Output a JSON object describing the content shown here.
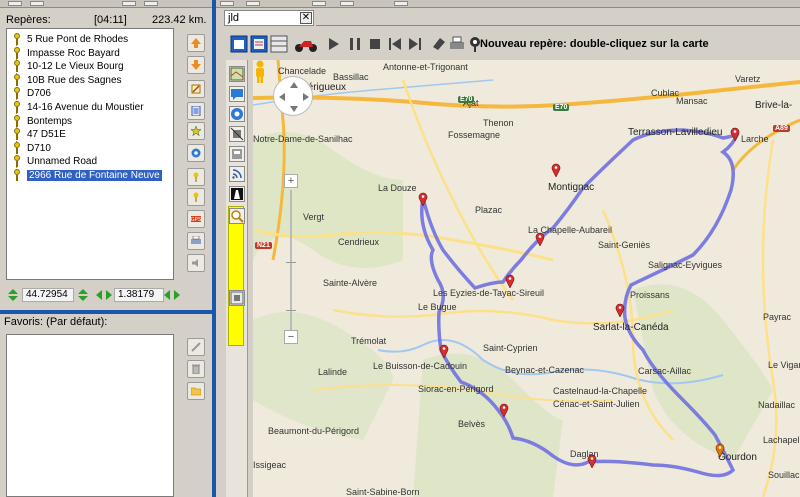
{
  "left_panel": {
    "waypoints_title": "Repères:",
    "duration": "[04:11]",
    "distance": "223.42 km.",
    "waypoints": [
      {
        "label": "5 Rue Pont de Rhodes",
        "selected": false
      },
      {
        "label": "Impasse Roc Bayard",
        "selected": false
      },
      {
        "label": "10-12 Le Vieux Bourg",
        "selected": false
      },
      {
        "label": "10B Rue des Sagnes",
        "selected": false
      },
      {
        "label": "D706",
        "selected": false
      },
      {
        "label": "14-16 Avenue du Moustier",
        "selected": false
      },
      {
        "label": "Bontemps",
        "selected": false
      },
      {
        "label": "47 D51E",
        "selected": false
      },
      {
        "label": "D710",
        "selected": false
      },
      {
        "label": "Unnamed Road",
        "selected": false
      },
      {
        "label": "2966 Rue de Fontaine Neuve",
        "selected": true
      }
    ],
    "latitude": "44.72954",
    "longitude": "1.38179",
    "favorites_title": "Favoris: (Par défaut):"
  },
  "side_buttons": {
    "icons": [
      "arrow-up-icon",
      "arrow-down-icon",
      "edit-icon",
      "document-icon",
      "star-icon",
      "puzzle-icon",
      "marker-up-icon",
      "marker-down-icon",
      "route-icon",
      "print-icon",
      "speaker-icon"
    ],
    "fav_icons": [
      "pencil-icon",
      "trash-icon",
      "folder-icon"
    ]
  },
  "map_view": {
    "tab_title": "jld",
    "hint": "Nouveau repère: double-cliquez sur la carte",
    "colors": {
      "route": "#7070e0",
      "highway": "#f5b83d",
      "main_road": "#fde08a",
      "river": "#a0c8f0",
      "forest": "#c8dcb0",
      "marker": "#d32f2f",
      "panel_blue": "#1a56b0",
      "yellow_tool": "#ffff00"
    },
    "towns": [
      {
        "name": "Périgueux",
        "big": true
      },
      {
        "name": "Chancelade",
        "big": false
      },
      {
        "name": "Bassillac",
        "big": false
      },
      {
        "name": "Antonne-et-Trigonant",
        "big": false
      },
      {
        "name": "Ajat",
        "big": false
      },
      {
        "name": "Thenon",
        "big": false
      },
      {
        "name": "Fossemagne",
        "big": false
      },
      {
        "name": "Notre-Dame-de-Sanilhac",
        "big": false
      },
      {
        "name": "Cublac",
        "big": false
      },
      {
        "name": "Mansac",
        "big": false
      },
      {
        "name": "Varetz",
        "big": false
      },
      {
        "name": "Brive-la-",
        "big": true
      },
      {
        "name": "Terrasson-Lavilledieu",
        "big": true
      },
      {
        "name": "Larche",
        "big": false
      },
      {
        "name": "La Douze",
        "big": false
      },
      {
        "name": "Vergt",
        "big": false
      },
      {
        "name": "Montignac",
        "big": true
      },
      {
        "name": "Plazac",
        "big": false
      },
      {
        "name": "La Chapelle-Aubareil",
        "big": false
      },
      {
        "name": "Cendrieux",
        "big": false
      },
      {
        "name": "Saint-Geniès",
        "big": false
      },
      {
        "name": "Salignac-Eyvigues",
        "big": false
      },
      {
        "name": "Sainte-Alvère",
        "big": false
      },
      {
        "name": "Les Eyzies-de-Tayac-Sireuil",
        "big": false
      },
      {
        "name": "Proissans",
        "big": false
      },
      {
        "name": "Le Bugue",
        "big": false
      },
      {
        "name": "Sarlat-la-Canéda",
        "big": true
      },
      {
        "name": "Trémolat",
        "big": false
      },
      {
        "name": "Saint-Cyprien",
        "big": false
      },
      {
        "name": "Le Buisson-de-Cadouin",
        "big": false
      },
      {
        "name": "Beynac-et-Cazenac",
        "big": false
      },
      {
        "name": "Carsac-Aillac",
        "big": false
      },
      {
        "name": "Lalinde",
        "big": false
      },
      {
        "name": "Siorac-en-Périgord",
        "big": false
      },
      {
        "name": "Castelnaud-la-Chapelle",
        "big": false
      },
      {
        "name": "Cénac-et-Saint-Julien",
        "big": false
      },
      {
        "name": "Belvès",
        "big": false
      },
      {
        "name": "Beaumont-du-Périgord",
        "big": false
      },
      {
        "name": "Daglan",
        "big": false
      },
      {
        "name": "Gourdon",
        "big": true
      },
      {
        "name": "Saint-Sabine-Born",
        "big": false
      },
      {
        "name": "Issigeac",
        "big": false
      },
      {
        "name": "Payrac",
        "big": false
      },
      {
        "name": "Le Vigan",
        "big": false
      },
      {
        "name": "Nadaillac",
        "big": false
      },
      {
        "name": "Lachapelle-Auzac",
        "big": false
      },
      {
        "name": "Souillac",
        "big": false
      }
    ],
    "road_shields": [
      {
        "label": "E70",
        "kind": "green"
      },
      {
        "label": "E70",
        "kind": "green"
      },
      {
        "label": "A89",
        "kind": "red"
      },
      {
        "label": "N21",
        "kind": "red"
      }
    ],
    "zoom_plus": "+",
    "zoom_minus": "−"
  }
}
